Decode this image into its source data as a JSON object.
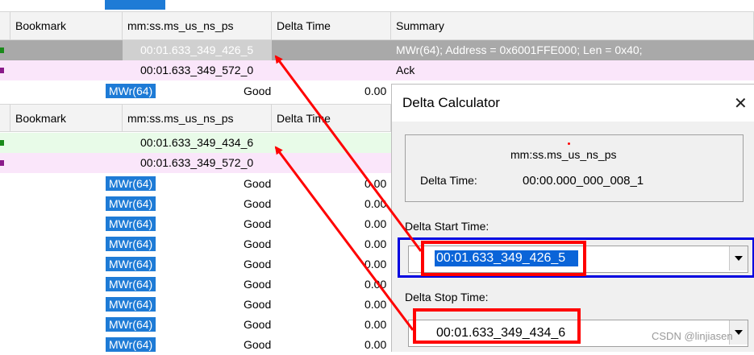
{
  "tables": {
    "top": {
      "headers": [
        "Bookmark",
        "mm:ss.ms_us_ns_ps",
        "Delta Time",
        "Summary"
      ],
      "rows": [
        {
          "time": "00:01.633_349_426_5",
          "summary": "MWr(64); Address = 0x6001FFE000; Len = 0x40;"
        },
        {
          "time": "00:01.633_349_572_0",
          "summary": "Ack"
        }
      ],
      "tlp_row": {
        "type": "MWr(64)",
        "status": "Good",
        "val": "0.00"
      }
    },
    "bottom": {
      "headers": [
        "Bookmark",
        "mm:ss.ms_us_ns_ps",
        "Delta Time"
      ],
      "rows": [
        {
          "time": "00:01.633_349_434_6"
        },
        {
          "time": "00:01.633_349_572_0"
        }
      ],
      "list": [
        {
          "type": "MWr(64)",
          "status": "Good",
          "val": "0.00"
        },
        {
          "type": "MWr(64)",
          "status": "Good",
          "val": "0.00"
        },
        {
          "type": "MWr(64)",
          "status": "Good",
          "val": "0.00"
        },
        {
          "type": "MWr(64)",
          "status": "Good",
          "val": "0.00"
        },
        {
          "type": "MWr(64)",
          "status": "Good",
          "val": "0.00"
        },
        {
          "type": "MWr(64)",
          "status": "Good",
          "val": "0.00"
        },
        {
          "type": "MWr(64)",
          "status": "Good",
          "val": "0.00"
        },
        {
          "type": "MWr(64)",
          "status": "Good",
          "val": "0.00"
        },
        {
          "type": "MWr(64)",
          "status": "Good",
          "val": "0.00"
        }
      ]
    }
  },
  "dialog": {
    "title": "Delta Calculator",
    "close_glyph": "✕",
    "format_label": "mm:ss.ms_us_ns_ps",
    "delta_time_label": "Delta Time:",
    "delta_time_value": "00:00.000_000_008_1",
    "start_label": "Delta Start Time:",
    "start_value": "00:01.633_349_426_5",
    "stop_label": "Delta Stop Time:",
    "stop_value": "00:01.633_349_434_6"
  },
  "watermark": "CSDN @linjiasen",
  "colors": {
    "accent_blue": "#1e7bd6",
    "annotation_red": "#ff0000",
    "selection_gray": "#a9a9a9",
    "green_row": "#e8fbe8",
    "pink_row": "#fae6fa"
  }
}
